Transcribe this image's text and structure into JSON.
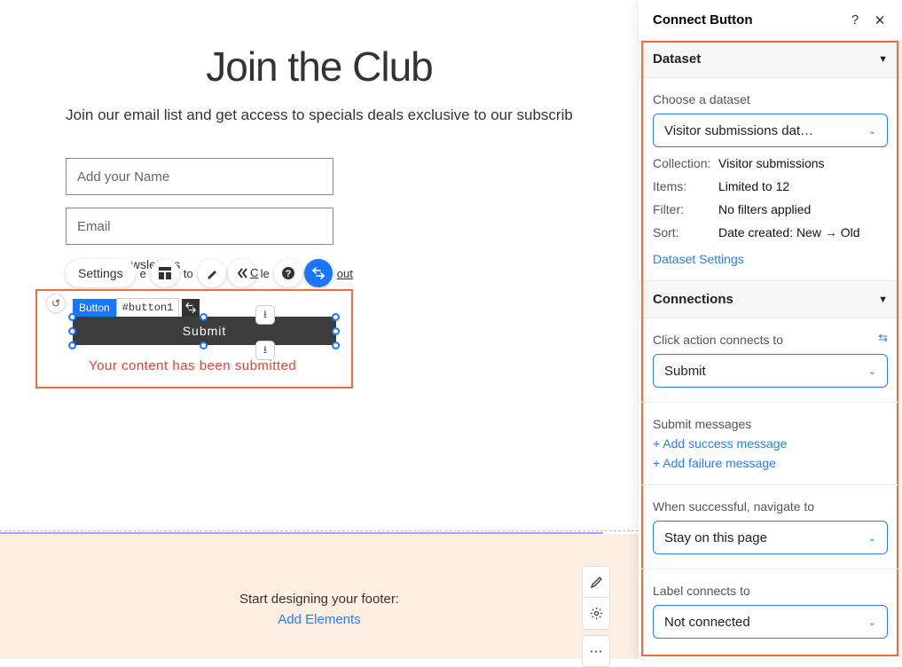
{
  "canvas": {
    "title": "Join the Club",
    "subtitle": "Join our email list and get access to specials deals exclusive to our subscrib",
    "name_placeholder": "Add your Name",
    "email_placeholder": "Email",
    "check_fragment_before": "e",
    "check_fragment_to": "to",
    "check_fragment_le": "le",
    "check_fragment_out": "out",
    "check_fragment_c": "C",
    "past_newsletters": "past newsletters",
    "settings_label": "Settings",
    "button_tag": "Button",
    "button_id": "#button1",
    "submit_label": "Submit",
    "submitted_msg": "Your content has been submitted"
  },
  "footer": {
    "line1": "Start designing your footer:",
    "line2": "Add Elements"
  },
  "panel": {
    "title": "Connect Button",
    "dataset": {
      "heading": "Dataset",
      "choose_label": "Choose a dataset",
      "selected": "Visitor submissions dat…",
      "collection_label": "Collection:",
      "collection_value": "Visitor submissions",
      "items_label": "Items:",
      "items_value": "Limited to 12",
      "filter_label": "Filter:",
      "filter_value": "No filters applied",
      "sort_label": "Sort:",
      "sort_value": "Date created: New → Old",
      "settings_link": "Dataset Settings"
    },
    "connections": {
      "heading": "Connections",
      "click_label": "Click action connects to",
      "click_value": "Submit",
      "submit_messages": "Submit messages",
      "add_success": "+ Add success message",
      "add_failure": "+ Add failure message",
      "nav_label": "When successful, navigate to",
      "nav_value": "Stay on this page",
      "label_connects": "Label connects to",
      "label_value": "Not connected"
    }
  }
}
